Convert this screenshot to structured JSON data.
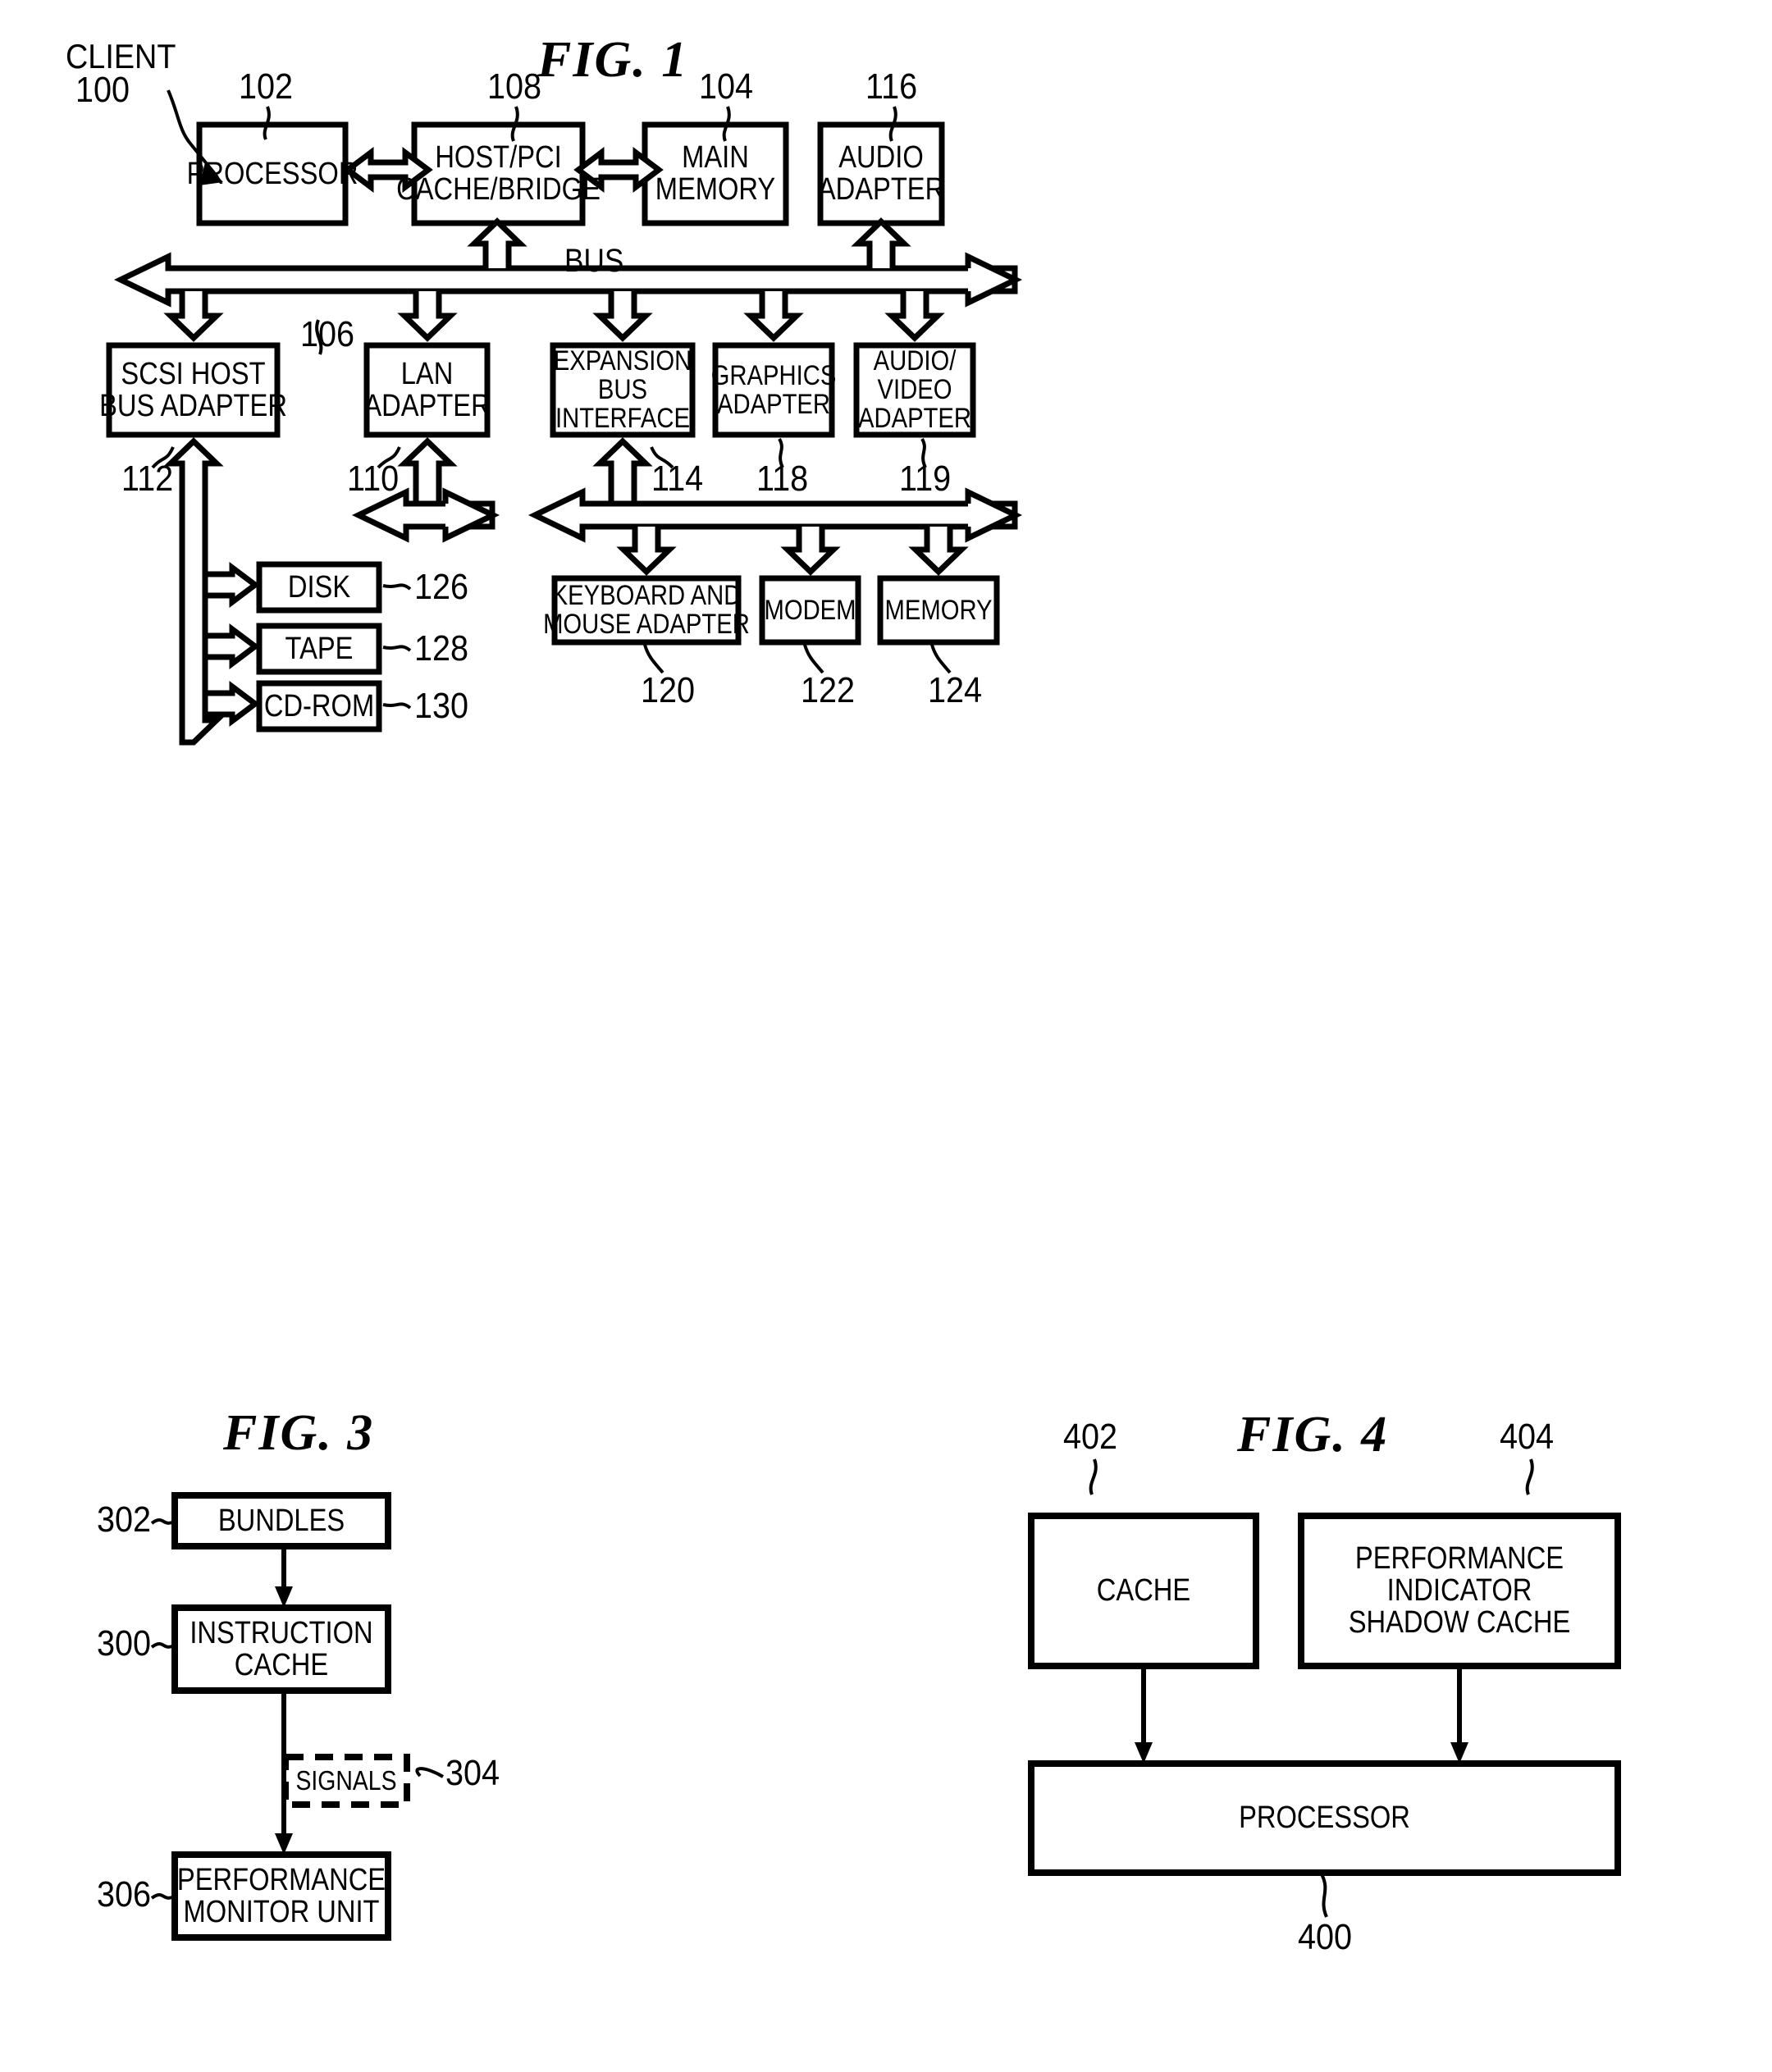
{
  "figures": [
    {
      "id": "fig1",
      "title": "FIG. 1",
      "system_label": "CLIENT",
      "system_ref": "100",
      "bus_label": "BUS",
      "bus_ref": "106",
      "blocks": [
        {
          "key": "processor",
          "label": "PROCESSOR",
          "ref": "102"
        },
        {
          "key": "host_pci",
          "label": "HOST/PCI\nCACHE/BRIDGE",
          "ref": "108"
        },
        {
          "key": "main_memory",
          "label": "MAIN\nMEMORY",
          "ref": "104"
        },
        {
          "key": "audio_adapter",
          "label": "AUDIO\nADAPTER",
          "ref": "116"
        },
        {
          "key": "scsi",
          "label": "SCSI HOST\nBUS ADAPTER",
          "ref": "112"
        },
        {
          "key": "lan",
          "label": "LAN\nADAPTER",
          "ref": "110"
        },
        {
          "key": "expansion",
          "label": "EXPANSION\nBUS\nINTERFACE",
          "ref": "114"
        },
        {
          "key": "graphics",
          "label": "GRAPHICS\nADAPTER",
          "ref": "118"
        },
        {
          "key": "audio_video",
          "label": "AUDIO/\nVIDEO\nADAPTER",
          "ref": "119"
        },
        {
          "key": "disk",
          "label": "DISK",
          "ref": "126"
        },
        {
          "key": "tape",
          "label": "TAPE",
          "ref": "128"
        },
        {
          "key": "cdrom",
          "label": "CD-ROM",
          "ref": "130"
        },
        {
          "key": "kbd_mouse",
          "label": "KEYBOARD AND\nMOUSE ADAPTER",
          "ref": "120"
        },
        {
          "key": "modem",
          "label": "MODEM",
          "ref": "122"
        },
        {
          "key": "memory",
          "label": "MEMORY",
          "ref": "124"
        }
      ]
    },
    {
      "id": "fig3",
      "title": "FIG. 3",
      "blocks": [
        {
          "key": "bundles",
          "label": "BUNDLES",
          "ref": "302"
        },
        {
          "key": "instr_cache",
          "label": "INSTRUCTION\nCACHE",
          "ref": "300"
        },
        {
          "key": "signals",
          "label": "SIGNALS",
          "ref": "304"
        },
        {
          "key": "pmu",
          "label": "PERFORMANCE\nMONITOR UNIT",
          "ref": "306"
        }
      ]
    },
    {
      "id": "fig4",
      "title": "FIG. 4",
      "blocks": [
        {
          "key": "cache",
          "label": "CACHE",
          "ref": "402"
        },
        {
          "key": "shadow_cache",
          "label": "PERFORMANCE\nINDICATOR\nSHADOW CACHE",
          "ref": "404"
        },
        {
          "key": "processor4",
          "label": "PROCESSOR",
          "ref": "400"
        }
      ]
    }
  ],
  "colors": {
    "ink": "#000000",
    "paper": "#ffffff"
  }
}
